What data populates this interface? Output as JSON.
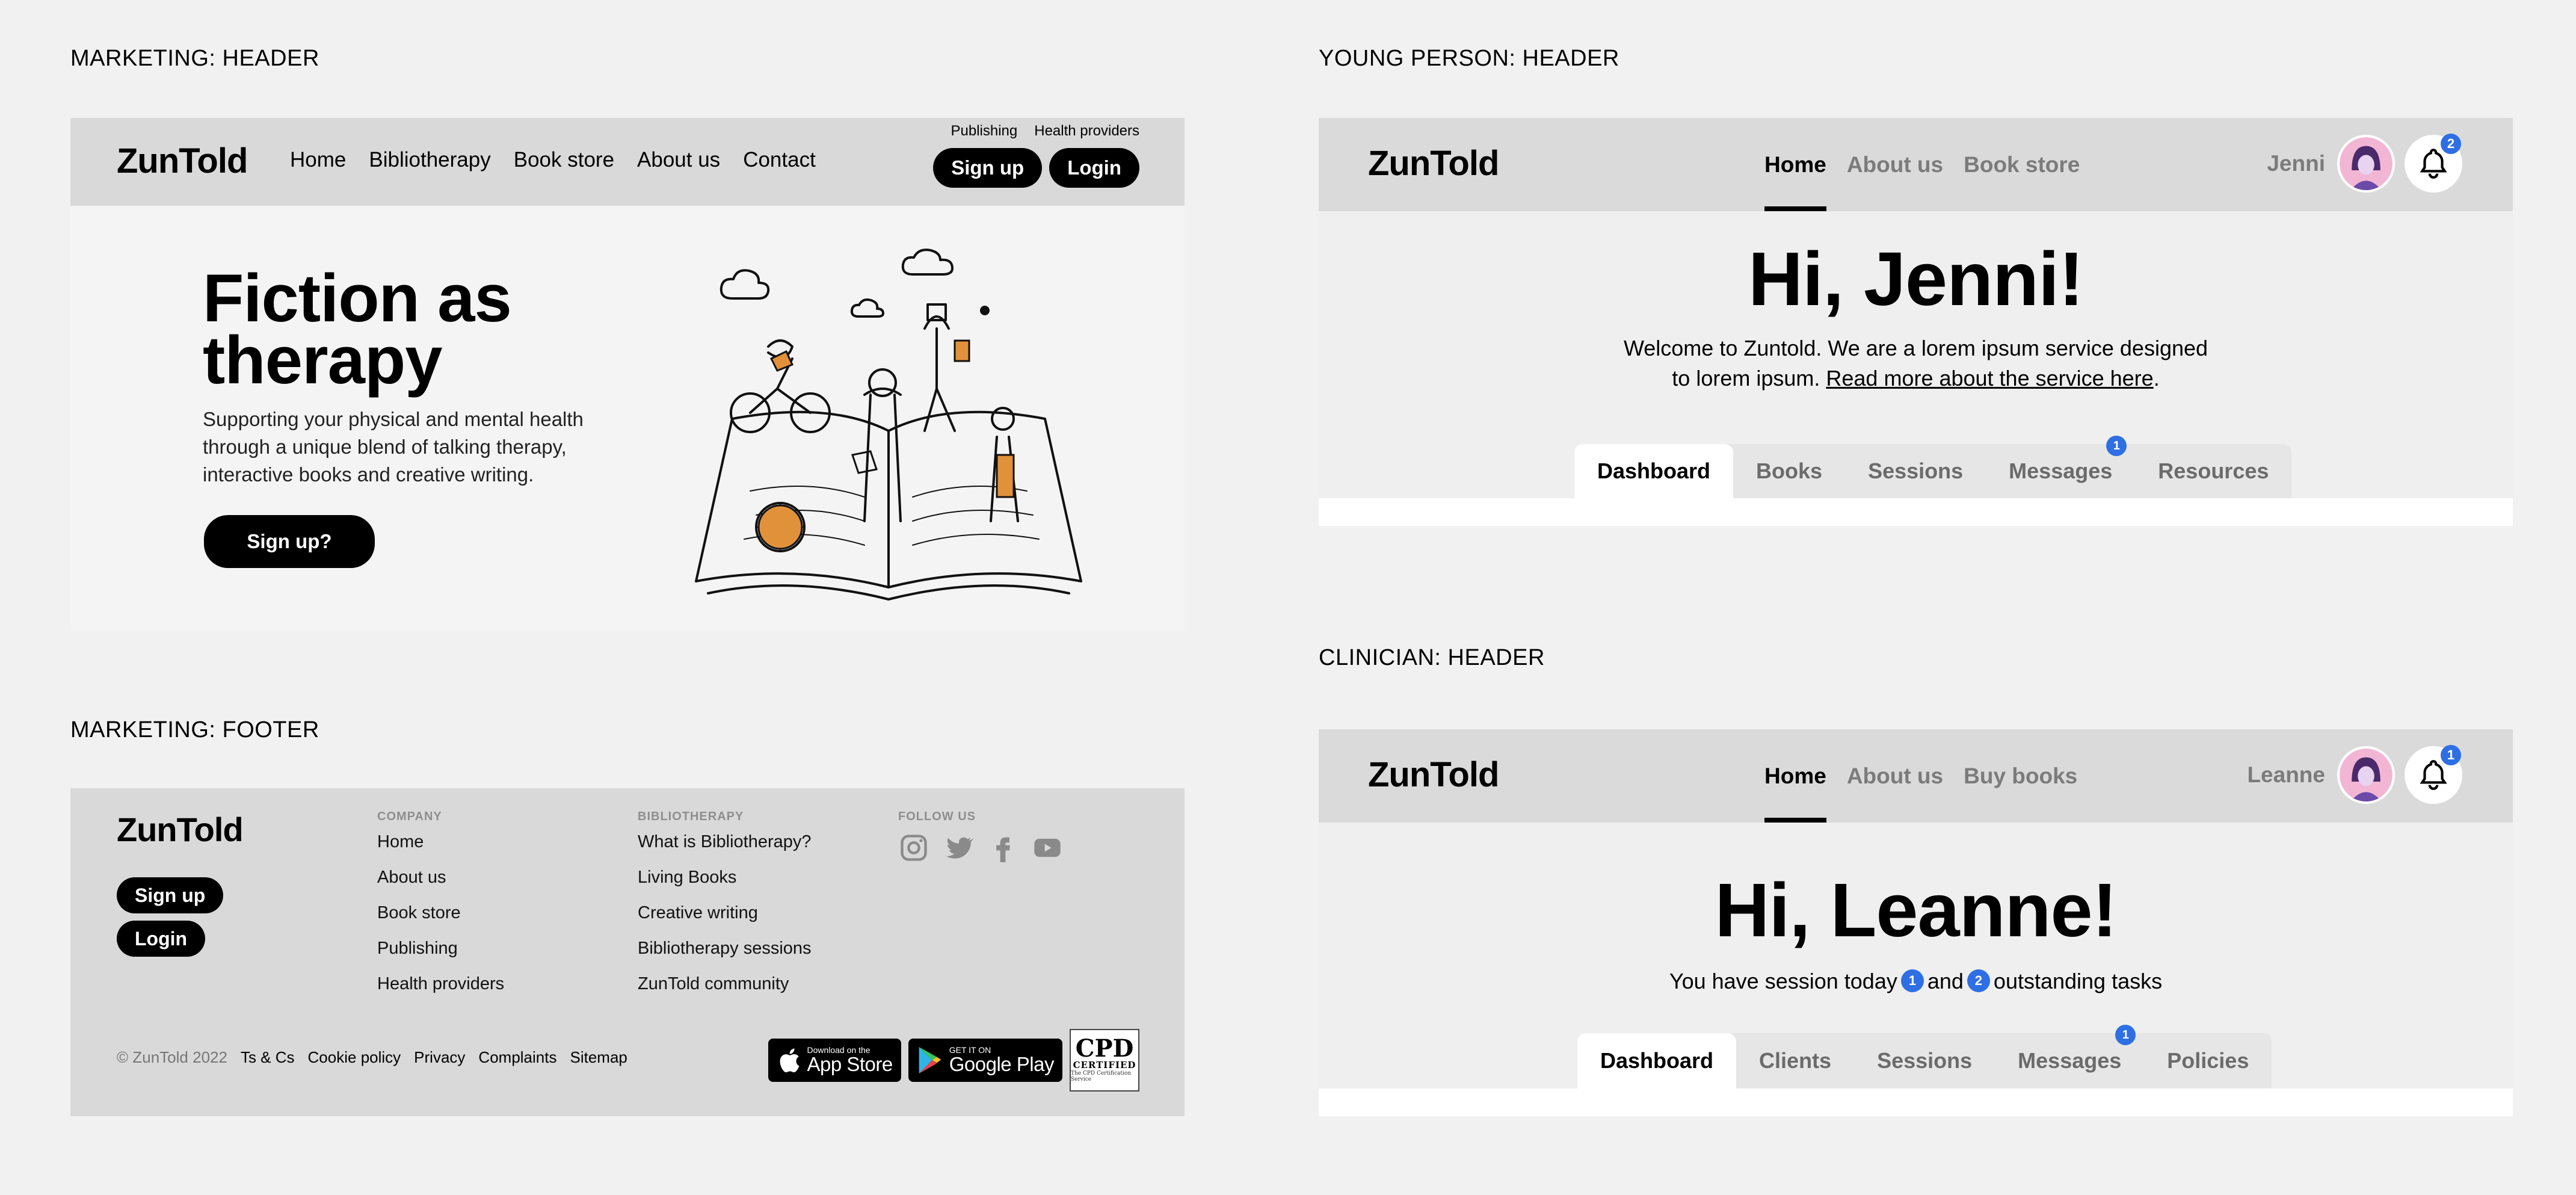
{
  "labels": {
    "marketing_header": "MARKETING: HEADER",
    "marketing_footer": "MARKETING: FOOTER",
    "young_person_header": "YOUNG PERSON: HEADER",
    "clinician_header": "CLINICIAN: HEADER"
  },
  "marketing_header": {
    "logo": "ZunTold",
    "nav": [
      "Home",
      "Bibliotherapy",
      "Book store",
      "About us",
      "Contact"
    ],
    "subnav": [
      "Publishing",
      "Health providers"
    ],
    "signup": "Sign up",
    "login": "Login",
    "hero_title_line1": "Fiction as",
    "hero_title_line2": "therapy",
    "hero_text": "Supporting your physical and mental health through a unique blend of talking therapy, interactive books and creative writing.",
    "hero_cta": "Sign up?"
  },
  "marketing_footer": {
    "logo": "ZunTold",
    "signup": "Sign up",
    "login": "Login",
    "company_heading": "COMPANY",
    "company_links": [
      "Home",
      "About us",
      "Book store",
      "Publishing",
      "Health providers"
    ],
    "bib_heading": "BIBLIOTHERAPY",
    "bib_links": [
      "What is Bibliotherapy?",
      "Living Books",
      "Creative writing",
      "Bibliotherapy sessions",
      "ZunTold community"
    ],
    "follow_heading": "FOLLOW US",
    "copyright": "© ZunTold 2022",
    "legal": [
      "Ts & Cs",
      "Cookie policy",
      "Privacy",
      "Complaints",
      "Sitemap"
    ],
    "appstore_small": "Download on the",
    "appstore_big": "App Store",
    "googleplay_small": "GET IT ON",
    "googleplay_big": "Google Play",
    "cpd_big": "CPD",
    "cpd_mid": "CERTIFIED",
    "cpd_small": "The CPD Certification Service"
  },
  "young_person": {
    "logo": "ZunTold",
    "nav": [
      "Home",
      "About us",
      "Book store"
    ],
    "user_name": "Jenni",
    "notif_count": "2",
    "greeting": "Hi, Jenni!",
    "welcome_line1": "Welcome to Zuntold. We are a lorem ipsum service designed",
    "welcome_line2_pre": "to lorem ipsum. ",
    "welcome_link": "Read more about the service here",
    "welcome_line2_post": ".",
    "tabs": [
      "Dashboard",
      "Books",
      "Sessions",
      "Messages",
      "Resources"
    ],
    "messages_badge": "1"
  },
  "clinician": {
    "logo": "ZunTold",
    "nav": [
      "Home",
      "About us",
      "Buy books"
    ],
    "user_name": "Leanne",
    "notif_count": "1",
    "greeting": "Hi, Leanne!",
    "status_pre": "You have session today",
    "session_count": "1",
    "status_mid": "and",
    "task_count": "2",
    "status_post": "outstanding tasks",
    "tabs": [
      "Dashboard",
      "Clients",
      "Sessions",
      "Messages",
      "Policies"
    ],
    "messages_badge": "1"
  },
  "colors": {
    "badge_blue": "#2e6fe3",
    "bar_grey": "#d9d9d9",
    "accent_orange": "#e0913a"
  }
}
